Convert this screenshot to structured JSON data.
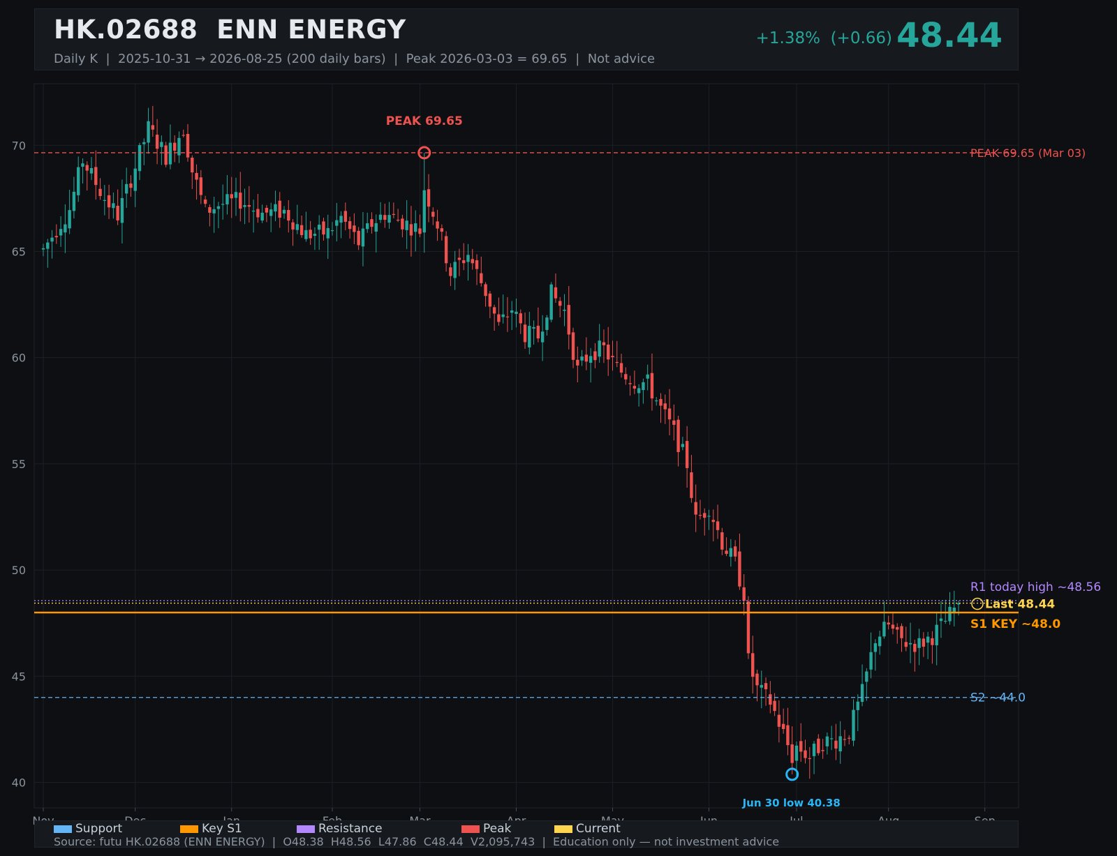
{
  "header": {
    "title": "HK.02688  ENN ENERGY",
    "subtitle": "Daily K  |  2025-10-31 → 2026-08-25 (200 daily bars)  |  Peak 2026-03-03 = 69.65  |  Not advice",
    "change": "+1.38%  (+0.66)",
    "price": "48.44"
  },
  "legend": {
    "items": [
      {
        "label": "Support",
        "color": "#64b5f6"
      },
      {
        "label": "Key S1",
        "color": "#ff9800"
      },
      {
        "label": "Resistance",
        "color": "#b388ff"
      },
      {
        "label": "Peak",
        "color": "#ef5350"
      },
      {
        "label": "Current",
        "color": "#ffd54f"
      }
    ],
    "source": "Source: futu HK.02688 (ENN ENERGY)  |  O48.38  H48.56  L47.86  C48.44  V2,095,743  |  Education only — not investment advice"
  },
  "colors": {
    "up": "#26a69a",
    "down": "#ef5350",
    "support": "#64b5f6",
    "key": "#ff9800",
    "resistance": "#b388ff",
    "peak": "#ef5350",
    "current": "#ffd54f",
    "low": "#29b6f6",
    "grid": "#1c2026",
    "axis_text": "#8b949e"
  },
  "chart_data": {
    "type": "candlestick",
    "ylim": [
      38.8,
      72.9
    ],
    "y_ticks": [
      40,
      45,
      50,
      55,
      60,
      65,
      70
    ],
    "x_tick_labels": [
      "Nov",
      "Dec",
      "Jan",
      "Feb",
      "Mar",
      "Apr",
      "May",
      "Jun",
      "Jul",
      "Aug",
      "Sep"
    ],
    "x_tick_index": [
      0,
      21,
      43,
      66,
      86,
      108,
      130,
      152,
      172,
      193,
      215
    ],
    "bar_count": 200,
    "anchors": [
      [
        0,
        65.1
      ],
      [
        6,
        67.0
      ],
      [
        9,
        69.3
      ],
      [
        14,
        67.5
      ],
      [
        17,
        66.7
      ],
      [
        21,
        69.0
      ],
      [
        24,
        70.8
      ],
      [
        28,
        69.5
      ],
      [
        32,
        70.8
      ],
      [
        34,
        68.8
      ],
      [
        37,
        66.9
      ],
      [
        40,
        67.2
      ],
      [
        45,
        67.4
      ],
      [
        50,
        66.8
      ],
      [
        55,
        66.9
      ],
      [
        60,
        65.8
      ],
      [
        65,
        65.9
      ],
      [
        68,
        66.6
      ],
      [
        72,
        65.4
      ],
      [
        75,
        66.3
      ],
      [
        78,
        66.8
      ],
      [
        82,
        66.4
      ],
      [
        86,
        66.0
      ],
      [
        87,
        68.0
      ],
      [
        90,
        66.3
      ],
      [
        93,
        64.0
      ],
      [
        97,
        64.9
      ],
      [
        101,
        63.1
      ],
      [
        104,
        61.5
      ],
      [
        107,
        62.3
      ],
      [
        110,
        61.1
      ],
      [
        113,
        61.0
      ],
      [
        116,
        63.0
      ],
      [
        119,
        62.2
      ],
      [
        122,
        59.4
      ],
      [
        125,
        60.3
      ],
      [
        128,
        60.4
      ],
      [
        131,
        59.5
      ],
      [
        135,
        58.9
      ],
      [
        138,
        58.8
      ],
      [
        141,
        57.6
      ],
      [
        144,
        56.5
      ],
      [
        147,
        55.0
      ],
      [
        149,
        52.3
      ],
      [
        152,
        53.0
      ],
      [
        155,
        51.3
      ],
      [
        158,
        50.3
      ],
      [
        160,
        48.9
      ],
      [
        161,
        45.7
      ],
      [
        163,
        44.4
      ],
      [
        166,
        43.8
      ],
      [
        169,
        42.3
      ],
      [
        171,
        41.2
      ],
      [
        172,
        41.7
      ],
      [
        175,
        41.2
      ],
      [
        178,
        41.9
      ],
      [
        181,
        42.0
      ],
      [
        184,
        42.4
      ],
      [
        187,
        44.2
      ],
      [
        190,
        46.8
      ],
      [
        193,
        47.4
      ],
      [
        195,
        46.8
      ],
      [
        197,
        46.6
      ],
      [
        200,
        46.5
      ],
      [
        203,
        46.9
      ],
      [
        206,
        47.6
      ],
      [
        209,
        48.44
      ]
    ],
    "levels": [
      {
        "name": "Peak",
        "value": 69.65,
        "label": "PEAK 69.65 (Mar 03)",
        "style": "dashed",
        "color_key": "peak"
      },
      {
        "name": "Resistance",
        "value": 48.56,
        "label": "R1 today high ~48.56",
        "style": "dotted",
        "color_key": "resistance"
      },
      {
        "name": "Current",
        "value": 48.44,
        "label": "Last 48.44",
        "style": "dotted",
        "color_key": "current"
      },
      {
        "name": "Key S1",
        "value": 48.0,
        "label": "S1 KEY ~48.0",
        "style": "solid",
        "color_key": "key"
      },
      {
        "name": "Support",
        "value": 44.0,
        "label": "S2 ~44.0",
        "style": "dashed",
        "color_key": "support"
      }
    ],
    "annotations": [
      {
        "label": "PEAK 69.65",
        "index": 87,
        "value": 69.65,
        "color_key": "peak"
      },
      {
        "label": "Jun 30 low 40.38",
        "index": 171,
        "value": 40.38,
        "color_key": "low"
      }
    ],
    "last": {
      "open": 48.38,
      "high": 48.56,
      "low": 47.86,
      "close": 48.44,
      "volume": "2,095,743"
    }
  }
}
